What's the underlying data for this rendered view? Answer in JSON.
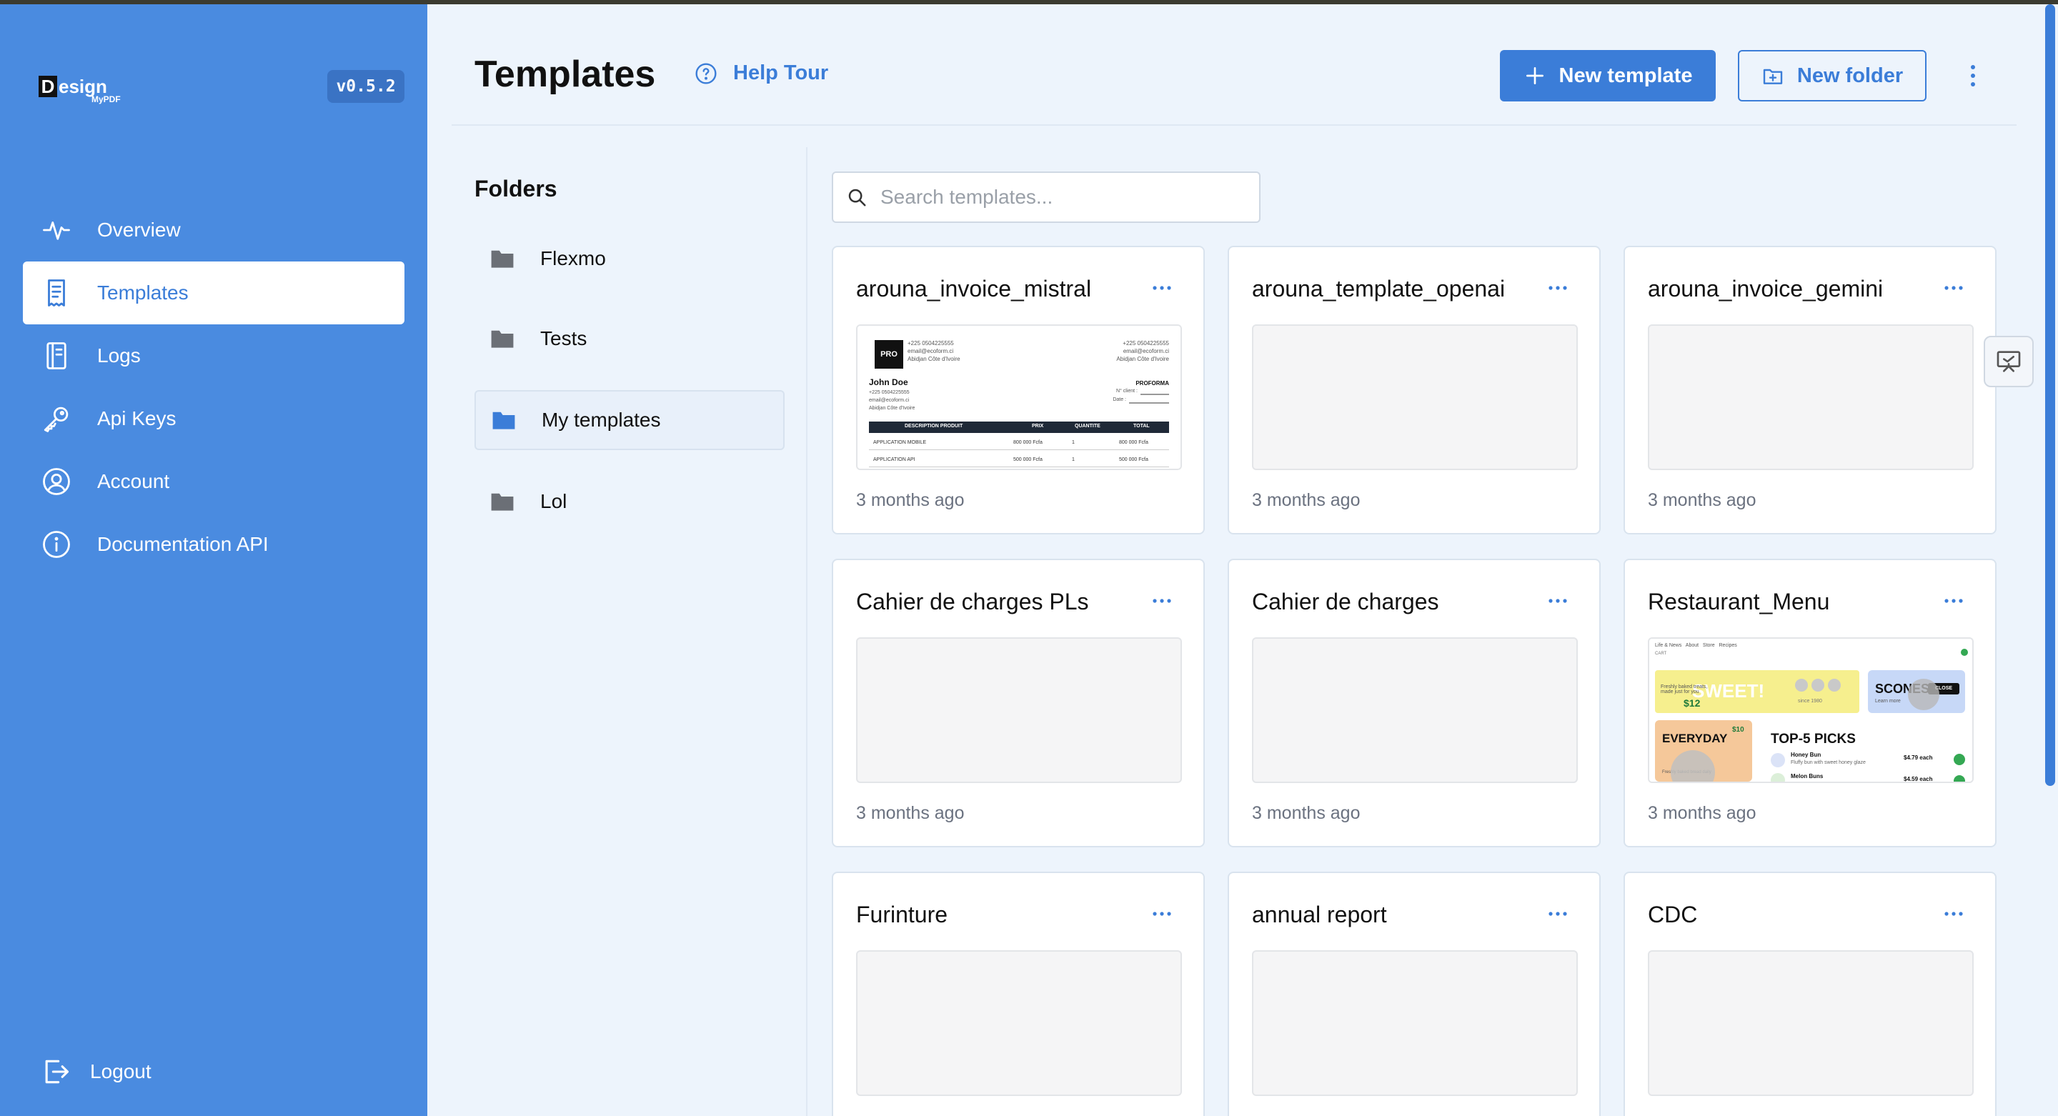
{
  "app": {
    "brand_letter": "D",
    "brand_word": "esign",
    "brand_sub": "MyPDF",
    "version": "v0.5.2",
    "accent_color": "#3b7dd8",
    "sidebar_color": "#4a8be0"
  },
  "sidebar": {
    "items": [
      {
        "label": "Overview",
        "icon": "activity-icon"
      },
      {
        "label": "Templates",
        "icon": "document-icon",
        "active": true
      },
      {
        "label": "Logs",
        "icon": "notebook-icon"
      },
      {
        "label": "Api Keys",
        "icon": "key-icon"
      },
      {
        "label": "Account",
        "icon": "user-circle-icon"
      },
      {
        "label": "Documentation API",
        "icon": "info-icon"
      }
    ],
    "logout_label": "Logout"
  },
  "header": {
    "title": "Templates",
    "help_tour": "Help Tour",
    "new_template": "New template",
    "new_folder": "New folder"
  },
  "folders": {
    "title": "Folders",
    "items": [
      {
        "label": "Flexmo"
      },
      {
        "label": "Tests"
      },
      {
        "label": "My templates",
        "active": true
      },
      {
        "label": "Lol"
      }
    ]
  },
  "search": {
    "placeholder": "Search templates...",
    "value": ""
  },
  "templates": [
    {
      "name": "arouna_invoice_mistral",
      "updated": "3 months ago",
      "thumbnail": "invoice"
    },
    {
      "name": "arouna_template_openai",
      "updated": "3 months ago",
      "thumbnail": "empty"
    },
    {
      "name": "arouna_invoice_gemini",
      "updated": "3 months ago",
      "thumbnail": "empty"
    },
    {
      "name": "Cahier de charges PLs",
      "updated": "3 months ago",
      "thumbnail": "empty"
    },
    {
      "name": "Cahier de charges",
      "updated": "3 months ago",
      "thumbnail": "empty"
    },
    {
      "name": "Restaurant_Menu",
      "updated": "3 months ago",
      "thumbnail": "menu"
    },
    {
      "name": "Furinture",
      "updated": "",
      "thumbnail": "empty"
    },
    {
      "name": "annual report",
      "updated": "",
      "thumbnail": "empty"
    },
    {
      "name": "CDC",
      "updated": "",
      "thumbnail": "empty"
    }
  ],
  "invoice_preview": {
    "logo": "PRO",
    "customer": "John Doe",
    "doc_type": "PROFORMA",
    "phone": "+225 0504225555",
    "email": "email@ecoform.ci",
    "city": "Abidjan Côte d'Ivoire",
    "client_label": "N° client :",
    "date_label": "Date :",
    "columns": [
      "DESCRIPTION PRODUIT",
      "PRIX",
      "QUANTITE",
      "TOTAL"
    ],
    "rows": [
      [
        "APPLICATION MOBILE",
        "800 000 Fcfa",
        "1",
        "800 000 Fcfa"
      ],
      [
        "APPLICATION API",
        "500 000 Fcfa",
        "1",
        "500 000 Fcfa"
      ]
    ]
  },
  "menu_preview": {
    "nav": "Life & News   About   Store   Recipes",
    "cart": "CART",
    "hero": "SWEET!",
    "hero_sub": "Freshly baked treats, made just for you",
    "hero_price": "$12",
    "hero_badge": "since 1980",
    "promo": "SCONES",
    "promo_sub": "Learn more",
    "promo_badge": "CLOSE",
    "everyday": "EVERYDAY",
    "everyday_price": "$10",
    "everyday_sub": "Freshly baked bread daily",
    "picks_title": "TOP-5 PICKS",
    "pick1": "Honey Bun",
    "pick1_desc": "Fluffy bun with sweet honey glaze",
    "pick1_price": "$4.79 each",
    "pick2": "Melon Buns",
    "pick2_price": "$4.59 each"
  }
}
